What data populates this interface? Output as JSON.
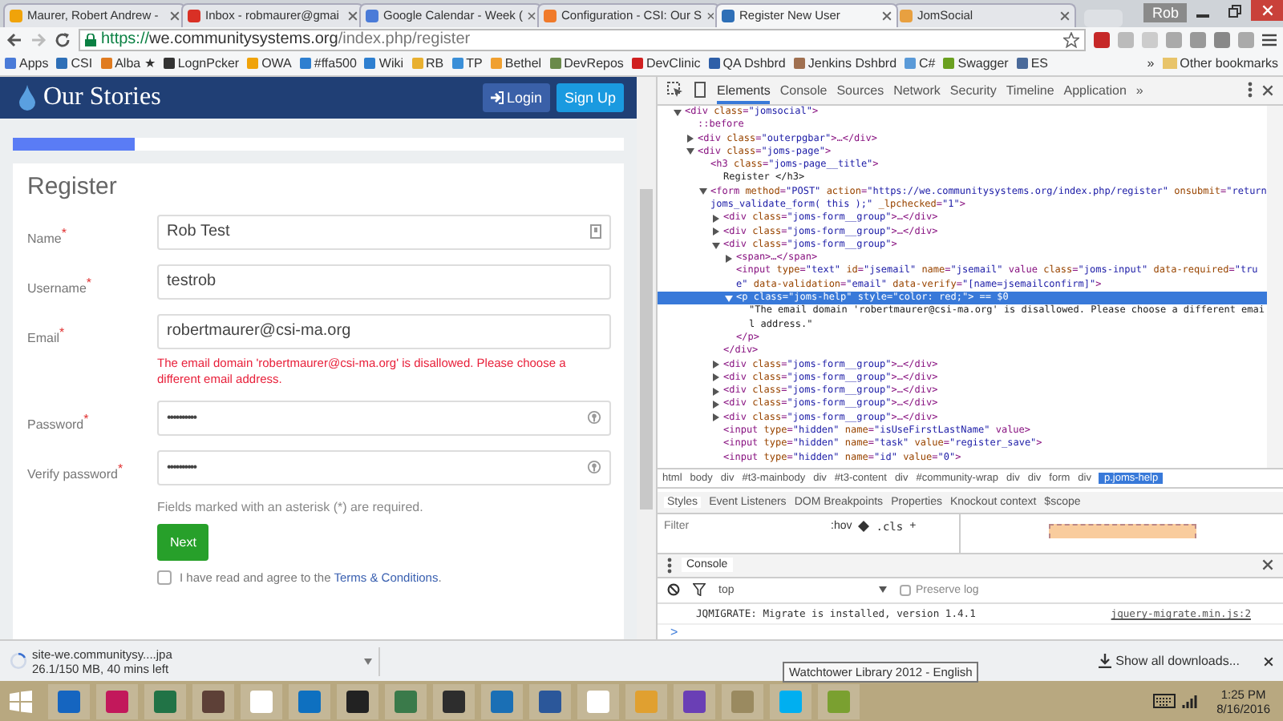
{
  "browser": {
    "tabs": [
      {
        "title": "Maurer, Robert Andrew -",
        "selected": false,
        "color": "#f0a30a"
      },
      {
        "title": "Inbox - robmaurer@gmai",
        "selected": false,
        "color": "#d93025"
      },
      {
        "title": "Google Calendar - Week (",
        "selected": false,
        "color": "#4a7bd8"
      },
      {
        "title": "Configuration - CSI: Our S",
        "selected": false,
        "color": "#f07a2a"
      },
      {
        "title": "Register New User",
        "selected": true,
        "color": "#2e6fb7"
      },
      {
        "title": "JomSocial",
        "selected": false,
        "color": "#e8a040"
      }
    ],
    "user": "Rob",
    "address": {
      "scheme": "https://",
      "host": "we.communitysystems.org",
      "path": "/index.php/register"
    },
    "bookmarks": [
      {
        "label": "Apps",
        "color": "#4a7bd8"
      },
      {
        "label": "CSI",
        "color": "#2e6fb7"
      },
      {
        "label": "Alba ★",
        "color": "#e07b20"
      },
      {
        "label": "LognPcker",
        "color": "#333333"
      },
      {
        "label": "OWA",
        "color": "#f0a30a"
      },
      {
        "label": "#ffa500",
        "color": "#2e7fd0"
      },
      {
        "label": "Wiki",
        "color": "#2e7fd0"
      },
      {
        "label": "RB",
        "color": "#e8b030"
      },
      {
        "label": "TP",
        "color": "#3a8fd8"
      },
      {
        "label": "Bethel",
        "color": "#f0a030"
      },
      {
        "label": "DevRepos",
        "color": "#6a8a4a"
      },
      {
        "label": "DevClinic",
        "color": "#d02020"
      },
      {
        "label": "QA Dshbrd",
        "color": "#2e5fa8"
      },
      {
        "label": "Jenkins Dshbrd",
        "color": "#a07050"
      },
      {
        "label": "C#",
        "color": "#5a9ad8"
      },
      {
        "label": "Swagger",
        "color": "#6aa020"
      },
      {
        "label": "ES",
        "color": "#4a6a9a"
      }
    ],
    "bookmarks_more": "»",
    "other_bookmarks": "Other bookmarks"
  },
  "page": {
    "site_title": "Our Stories",
    "login": "Login",
    "signup": "Sign Up",
    "progress": {
      "level": 0.2
    },
    "heading": "Register",
    "fields": [
      {
        "label": "Name",
        "required": true,
        "kind": "text",
        "value": "Rob Test"
      },
      {
        "label": "Username",
        "required": true,
        "kind": "text",
        "value": "testrob"
      },
      {
        "label": "Email",
        "required": true,
        "kind": "text",
        "value": "robertmaurer@csi-ma.org",
        "error": "The email domain 'robertmaurer@csi-ma.org' is disallowed. Please choose a different email address."
      },
      {
        "label": "Password",
        "required": true,
        "kind": "password",
        "value": "••••••••••"
      },
      {
        "label": "Verify password",
        "required": true,
        "kind": "password",
        "value": "••••••••••"
      }
    ],
    "asterisk": "*",
    "note": "Fields marked with an asterisk (*) are required.",
    "next": "Next",
    "terms": {
      "checked": false,
      "text": "I have read and agree to the",
      "link": "Terms & Conditions",
      "after": "."
    }
  },
  "devtools": {
    "tabs": [
      {
        "label": "Elements",
        "selected": true
      },
      {
        "label": "Console",
        "selected": false
      },
      {
        "label": "Sources",
        "selected": false
      },
      {
        "label": "Network",
        "selected": false
      },
      {
        "label": "Security",
        "selected": false
      },
      {
        "label": "Timeline",
        "selected": false
      },
      {
        "label": "Application",
        "selected": false
      }
    ],
    "tabs_more": "»",
    "elements_tree": [
      {
        "kind": "open",
        "selected": false,
        "text": "<div class=\"jomsocial\">",
        "children": [
          {
            "kind": "pseudo",
            "selected": false,
            "text": "::before"
          },
          {
            "kind": "collapsed",
            "selected": false,
            "text": "<div class=\"outerpgbar\">…</div>"
          },
          {
            "kind": "open",
            "selected": false,
            "text": "<div class=\"joms-page\">",
            "children": [
              {
                "kind": "leaf",
                "selected": false,
                "text": "<h3 class=\"joms-page__title\">",
                "children": [
                  {
                    "kind": "text",
                    "selected": false,
                    "text": "Register    </h3>"
                  }
                ]
              },
              {
                "kind": "open",
                "selected": false,
                "text": "<form method=\"POST\" action=\"https://we.communitysystems.org/index.php/register\" onsubmit=\"return joms_validate_form( this );\" _lpchecked=\"1\">",
                "children": [
                  {
                    "kind": "collapsed",
                    "selected": false,
                    "text": "<div class=\"joms-form__group\">…</div>"
                  },
                  {
                    "kind": "collapsed",
                    "selected": false,
                    "text": "<div class=\"joms-form__group\">…</div>"
                  },
                  {
                    "kind": "open",
                    "selected": false,
                    "text": "<div class=\"joms-form__group\">",
                    "close": "</div>",
                    "children": [
                      {
                        "kind": "collapsed",
                        "selected": false,
                        "text": "<span>…</span>"
                      },
                      {
                        "kind": "leaf",
                        "selected": false,
                        "text": "<input type=\"text\" id=\"jsemail\" name=\"jsemail\" value class=\"joms-input\" data-required=\"true\" data-validation=\"email\" data-verify=\"[name=jsemailconfirm]\">"
                      },
                      {
                        "kind": "open",
                        "selected": true,
                        "text": "<p class=\"joms-help\" style=\"color: red;\"> == $0",
                        "close": "</p>",
                        "children": [
                          {
                            "kind": "text",
                            "selected": false,
                            "text": "\"The email domain 'robertmaurer@csi-ma.org' is disallowed. Please choose a different email address.\""
                          }
                        ]
                      }
                    ]
                  },
                  {
                    "kind": "collapsed",
                    "selected": false,
                    "text": "<div class=\"joms-form__group\">…</div>"
                  },
                  {
                    "kind": "collapsed",
                    "selected": false,
                    "text": "<div class=\"joms-form__group\">…</div>"
                  },
                  {
                    "kind": "collapsed",
                    "selected": false,
                    "text": "<div class=\"joms-form__group\">…</div>"
                  },
                  {
                    "kind": "collapsed",
                    "selected": false,
                    "text": "<div class=\"joms-form__group\">…</div>"
                  },
                  {
                    "kind": "collapsed",
                    "selected": false,
                    "text": "<div class=\"joms-form__group\">…</div>"
                  },
                  {
                    "kind": "leaf",
                    "selected": false,
                    "text": "<input type=\"hidden\" name=\"isUseFirstLastName\" value>"
                  },
                  {
                    "kind": "leaf",
                    "selected": false,
                    "text": "<input type=\"hidden\" name=\"task\" value=\"register_save\">"
                  },
                  {
                    "kind": "leaf",
                    "selected": false,
                    "text": "<input type=\"hidden\" name=\"id\" value=\"0\">"
                  }
                ]
              }
            ]
          }
        ]
      }
    ],
    "breadcrumbs": [
      {
        "label": "html",
        "selected": false
      },
      {
        "label": "body",
        "selected": false
      },
      {
        "label": "div",
        "selected": false
      },
      {
        "label": "#t3-mainbody",
        "selected": false
      },
      {
        "label": "div",
        "selected": false
      },
      {
        "label": "#t3-content",
        "selected": false
      },
      {
        "label": "div",
        "selected": false
      },
      {
        "label": "#community-wrap",
        "selected": false
      },
      {
        "label": "div",
        "selected": false
      },
      {
        "label": "div",
        "selected": false
      },
      {
        "label": "form",
        "selected": false
      },
      {
        "label": "div",
        "selected": false
      },
      {
        "label": "p.joms-help",
        "selected": true
      }
    ],
    "style_tabs": [
      {
        "label": "Styles",
        "selected": true
      },
      {
        "label": "Event Listeners",
        "selected": false
      },
      {
        "label": "DOM Breakpoints",
        "selected": false
      },
      {
        "label": "Properties",
        "selected": false
      },
      {
        "label": "Knockout context",
        "selected": false
      },
      {
        "label": "$scope",
        "selected": false
      }
    ],
    "filter": {
      "placeholder": "Filter",
      "hov": ":hov",
      "cls": ".cls",
      "add": "+"
    },
    "console": {
      "tab": "Console",
      "context": "top",
      "preserve_log": {
        "label": "Preserve log",
        "checked": false
      },
      "messages": [
        {
          "text": "JQMIGRATE: Migrate is installed, version 1.4.1",
          "source": "jquery-migrate.min.js:2"
        }
      ],
      "prompt": ">"
    }
  },
  "downloads": {
    "level": 0.174,
    "file": "site-we.communitysy....jpa",
    "progress": "26.1/150 MB, 40 mins left",
    "show_all": "Show all downloads..."
  },
  "tooltip": "Watchtower Library 2012 - English",
  "taskbar": {
    "time": "1:25 PM",
    "date": "8/16/2016"
  }
}
